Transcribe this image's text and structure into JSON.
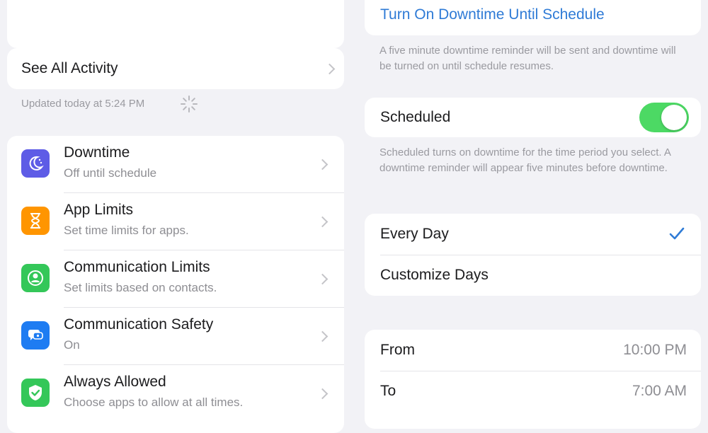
{
  "left": {
    "see_all_activity": "See All Activity",
    "updated_text": "Updated today at 5:24 PM",
    "items": [
      {
        "title": "Downtime",
        "subtitle": "Off until schedule",
        "icon": "downtime-icon",
        "color": "#5e5ce6"
      },
      {
        "title": "App Limits",
        "subtitle": "Set time limits for apps.",
        "icon": "hourglass-icon",
        "color": "#ff9500"
      },
      {
        "title": "Communication Limits",
        "subtitle": "Set limits based on contacts.",
        "icon": "person-circle-icon",
        "color": "#34c759"
      },
      {
        "title": "Communication Safety",
        "subtitle": "On",
        "icon": "chat-bubble-icon",
        "color": "#1e7cf2"
      },
      {
        "title": "Always Allowed",
        "subtitle": "Choose apps to allow at all times.",
        "icon": "checkmark-shield-icon",
        "color": "#34c759"
      }
    ]
  },
  "right": {
    "turn_on_link": "Turn On Downtime Until Schedule",
    "reminder_note": "A five minute downtime reminder will be sent and downtime will be turned on until schedule resumes.",
    "scheduled_label": "Scheduled",
    "scheduled_on": true,
    "scheduled_note": "Scheduled turns on downtime for the time period you select. A downtime reminder will appear five minutes before downtime.",
    "every_day": "Every Day",
    "customize_days": "Customize Days",
    "from_label": "From",
    "from_value": "10:00 PM",
    "to_label": "To",
    "to_value": "7:00 AM"
  },
  "colors": {
    "accent_blue": "#2f7bd6",
    "toggle_green": "#4cd964"
  }
}
